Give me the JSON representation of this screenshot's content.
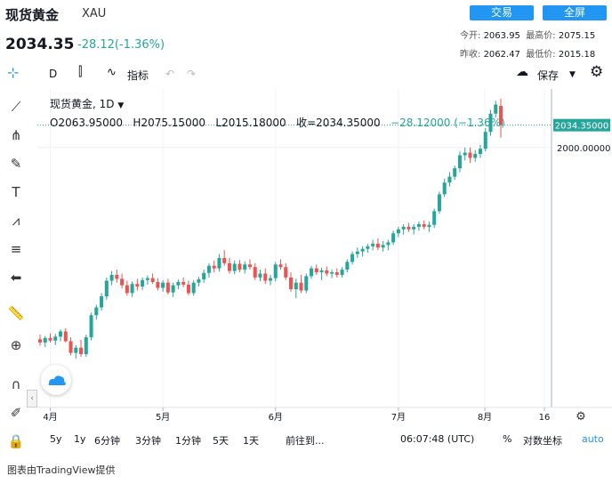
{
  "header": {
    "title": "现货黄金",
    "symbol": "XAU",
    "price": "2034.35",
    "change": "-28.12(-1.36%)",
    "trade_label": "交易",
    "fullscreen_label": "全屏",
    "open_label": "今开:",
    "open_value": "2063.95",
    "high_label": "最高价:",
    "high_value": "2075.15",
    "prev_close_label": "昨收:",
    "prev_close_value": "2062.47",
    "low_label": "最低价:",
    "low_value": "2015.18"
  },
  "toolbar": {
    "interval": "D",
    "indicators_label": "指标",
    "save_label": "保存"
  },
  "legend": {
    "line1": "现货黄金, 1D",
    "ohlc": "O2063.95000   H2075.15000   L2015.18000   收=2034.35000",
    "change": "−28.12000 (−1.36%)"
  },
  "bottom_bar": {
    "ranges": [
      "5y",
      "1y",
      "6分钟",
      "3分钟",
      "1分钟",
      "5天",
      "1天"
    ],
    "goto_label": "前往到...",
    "time": "06:07:48 (UTC)",
    "percent_label": "%",
    "log_label": "对数坐标",
    "auto_label": "auto"
  },
  "footer": "图表由TradingView提供",
  "chart_data": {
    "type": "candlestick",
    "title": "现货黄金, 1D",
    "x_tick_labels": [
      "4月",
      "5月",
      "6月",
      "7月",
      "8月",
      "16"
    ],
    "y_tick_labels": [
      "2000.00000"
    ],
    "last_price_label": "2034.35000",
    "ylim": [
      1600,
      2090
    ],
    "colors": {
      "up": "#26a69a",
      "down": "#ef5350",
      "price_line": "#26a69a"
    },
    "candles": [
      {
        "o": 1705,
        "h": 1712,
        "l": 1695,
        "c": 1700
      },
      {
        "o": 1700,
        "h": 1710,
        "l": 1693,
        "c": 1707
      },
      {
        "o": 1707,
        "h": 1714,
        "l": 1700,
        "c": 1703
      },
      {
        "o": 1703,
        "h": 1713,
        "l": 1696,
        "c": 1709
      },
      {
        "o": 1709,
        "h": 1720,
        "l": 1702,
        "c": 1717
      },
      {
        "o": 1717,
        "h": 1722,
        "l": 1700,
        "c": 1702
      },
      {
        "o": 1702,
        "h": 1708,
        "l": 1680,
        "c": 1684
      },
      {
        "o": 1684,
        "h": 1696,
        "l": 1675,
        "c": 1692
      },
      {
        "o": 1692,
        "h": 1704,
        "l": 1678,
        "c": 1682
      },
      {
        "o": 1682,
        "h": 1712,
        "l": 1678,
        "c": 1708
      },
      {
        "o": 1708,
        "h": 1746,
        "l": 1703,
        "c": 1742
      },
      {
        "o": 1742,
        "h": 1758,
        "l": 1735,
        "c": 1754
      },
      {
        "o": 1754,
        "h": 1776,
        "l": 1749,
        "c": 1771
      },
      {
        "o": 1771,
        "h": 1800,
        "l": 1766,
        "c": 1795
      },
      {
        "o": 1795,
        "h": 1810,
        "l": 1788,
        "c": 1804
      },
      {
        "o": 1804,
        "h": 1812,
        "l": 1792,
        "c": 1798
      },
      {
        "o": 1798,
        "h": 1806,
        "l": 1783,
        "c": 1788
      },
      {
        "o": 1788,
        "h": 1795,
        "l": 1772,
        "c": 1776
      },
      {
        "o": 1776,
        "h": 1794,
        "l": 1770,
        "c": 1790
      },
      {
        "o": 1790,
        "h": 1798,
        "l": 1780,
        "c": 1786
      },
      {
        "o": 1786,
        "h": 1800,
        "l": 1781,
        "c": 1796
      },
      {
        "o": 1796,
        "h": 1803,
        "l": 1789,
        "c": 1799
      },
      {
        "o": 1799,
        "h": 1806,
        "l": 1790,
        "c": 1793
      },
      {
        "o": 1793,
        "h": 1799,
        "l": 1780,
        "c": 1784
      },
      {
        "o": 1784,
        "h": 1796,
        "l": 1778,
        "c": 1792
      },
      {
        "o": 1792,
        "h": 1798,
        "l": 1774,
        "c": 1777
      },
      {
        "o": 1777,
        "h": 1792,
        "l": 1770,
        "c": 1788
      },
      {
        "o": 1788,
        "h": 1797,
        "l": 1782,
        "c": 1793
      },
      {
        "o": 1793,
        "h": 1800,
        "l": 1785,
        "c": 1789
      },
      {
        "o": 1789,
        "h": 1795,
        "l": 1773,
        "c": 1776
      },
      {
        "o": 1776,
        "h": 1796,
        "l": 1772,
        "c": 1792
      },
      {
        "o": 1792,
        "h": 1801,
        "l": 1786,
        "c": 1797
      },
      {
        "o": 1797,
        "h": 1812,
        "l": 1792,
        "c": 1807
      },
      {
        "o": 1807,
        "h": 1822,
        "l": 1800,
        "c": 1818
      },
      {
        "o": 1818,
        "h": 1826,
        "l": 1808,
        "c": 1814
      },
      {
        "o": 1814,
        "h": 1836,
        "l": 1809,
        "c": 1830
      },
      {
        "o": 1830,
        "h": 1842,
        "l": 1818,
        "c": 1822
      },
      {
        "o": 1822,
        "h": 1830,
        "l": 1806,
        "c": 1810
      },
      {
        "o": 1810,
        "h": 1826,
        "l": 1805,
        "c": 1821
      },
      {
        "o": 1821,
        "h": 1827,
        "l": 1808,
        "c": 1812
      },
      {
        "o": 1812,
        "h": 1825,
        "l": 1806,
        "c": 1820
      },
      {
        "o": 1820,
        "h": 1828,
        "l": 1812,
        "c": 1816
      },
      {
        "o": 1816,
        "h": 1822,
        "l": 1796,
        "c": 1800
      },
      {
        "o": 1800,
        "h": 1812,
        "l": 1794,
        "c": 1806
      },
      {
        "o": 1806,
        "h": 1814,
        "l": 1790,
        "c": 1795
      },
      {
        "o": 1795,
        "h": 1804,
        "l": 1788,
        "c": 1799
      },
      {
        "o": 1799,
        "h": 1824,
        "l": 1794,
        "c": 1820
      },
      {
        "o": 1820,
        "h": 1828,
        "l": 1812,
        "c": 1816
      },
      {
        "o": 1816,
        "h": 1822,
        "l": 1796,
        "c": 1800
      },
      {
        "o": 1800,
        "h": 1808,
        "l": 1778,
        "c": 1782
      },
      {
        "o": 1782,
        "h": 1798,
        "l": 1768,
        "c": 1792
      },
      {
        "o": 1792,
        "h": 1804,
        "l": 1776,
        "c": 1780
      },
      {
        "o": 1780,
        "h": 1806,
        "l": 1776,
        "c": 1802
      },
      {
        "o": 1802,
        "h": 1818,
        "l": 1798,
        "c": 1814
      },
      {
        "o": 1814,
        "h": 1820,
        "l": 1804,
        "c": 1808
      },
      {
        "o": 1808,
        "h": 1815,
        "l": 1796,
        "c": 1811
      },
      {
        "o": 1811,
        "h": 1817,
        "l": 1802,
        "c": 1806
      },
      {
        "o": 1806,
        "h": 1812,
        "l": 1799,
        "c": 1808
      },
      {
        "o": 1808,
        "h": 1814,
        "l": 1800,
        "c": 1804
      },
      {
        "o": 1804,
        "h": 1816,
        "l": 1800,
        "c": 1812
      },
      {
        "o": 1812,
        "h": 1828,
        "l": 1808,
        "c": 1824
      },
      {
        "o": 1824,
        "h": 1840,
        "l": 1820,
        "c": 1836
      },
      {
        "o": 1836,
        "h": 1846,
        "l": 1830,
        "c": 1840
      },
      {
        "o": 1840,
        "h": 1848,
        "l": 1832,
        "c": 1844
      },
      {
        "o": 1844,
        "h": 1852,
        "l": 1838,
        "c": 1848
      },
      {
        "o": 1848,
        "h": 1858,
        "l": 1842,
        "c": 1852
      },
      {
        "o": 1852,
        "h": 1860,
        "l": 1842,
        "c": 1846
      },
      {
        "o": 1846,
        "h": 1856,
        "l": 1840,
        "c": 1850
      },
      {
        "o": 1850,
        "h": 1858,
        "l": 1842,
        "c": 1854
      },
      {
        "o": 1854,
        "h": 1872,
        "l": 1850,
        "c": 1868
      },
      {
        "o": 1868,
        "h": 1878,
        "l": 1862,
        "c": 1874
      },
      {
        "o": 1874,
        "h": 1882,
        "l": 1866,
        "c": 1878
      },
      {
        "o": 1878,
        "h": 1884,
        "l": 1870,
        "c": 1874
      },
      {
        "o": 1874,
        "h": 1882,
        "l": 1866,
        "c": 1878
      },
      {
        "o": 1878,
        "h": 1886,
        "l": 1872,
        "c": 1882
      },
      {
        "o": 1882,
        "h": 1888,
        "l": 1874,
        "c": 1878
      },
      {
        "o": 1878,
        "h": 1886,
        "l": 1870,
        "c": 1881
      },
      {
        "o": 1881,
        "h": 1906,
        "l": 1876,
        "c": 1902
      },
      {
        "o": 1902,
        "h": 1932,
        "l": 1898,
        "c": 1928
      },
      {
        "o": 1928,
        "h": 1952,
        "l": 1924,
        "c": 1946
      },
      {
        "o": 1946,
        "h": 1962,
        "l": 1940,
        "c": 1955
      },
      {
        "o": 1955,
        "h": 1972,
        "l": 1950,
        "c": 1968
      },
      {
        "o": 1968,
        "h": 1994,
        "l": 1962,
        "c": 1988
      },
      {
        "o": 1988,
        "h": 2000,
        "l": 1980,
        "c": 1992
      },
      {
        "o": 1992,
        "h": 2000,
        "l": 1976,
        "c": 1984
      },
      {
        "o": 1984,
        "h": 1996,
        "l": 1978,
        "c": 1990
      },
      {
        "o": 1990,
        "h": 2004,
        "l": 1984,
        "c": 1998
      },
      {
        "o": 1998,
        "h": 2030,
        "l": 1994,
        "c": 2024
      },
      {
        "o": 2024,
        "h": 2058,
        "l": 2018,
        "c": 2052
      },
      {
        "o": 2052,
        "h": 2072,
        "l": 2046,
        "c": 2066
      },
      {
        "o": 2063.95,
        "h": 2075.15,
        "l": 2015.18,
        "c": 2034.35
      }
    ]
  }
}
